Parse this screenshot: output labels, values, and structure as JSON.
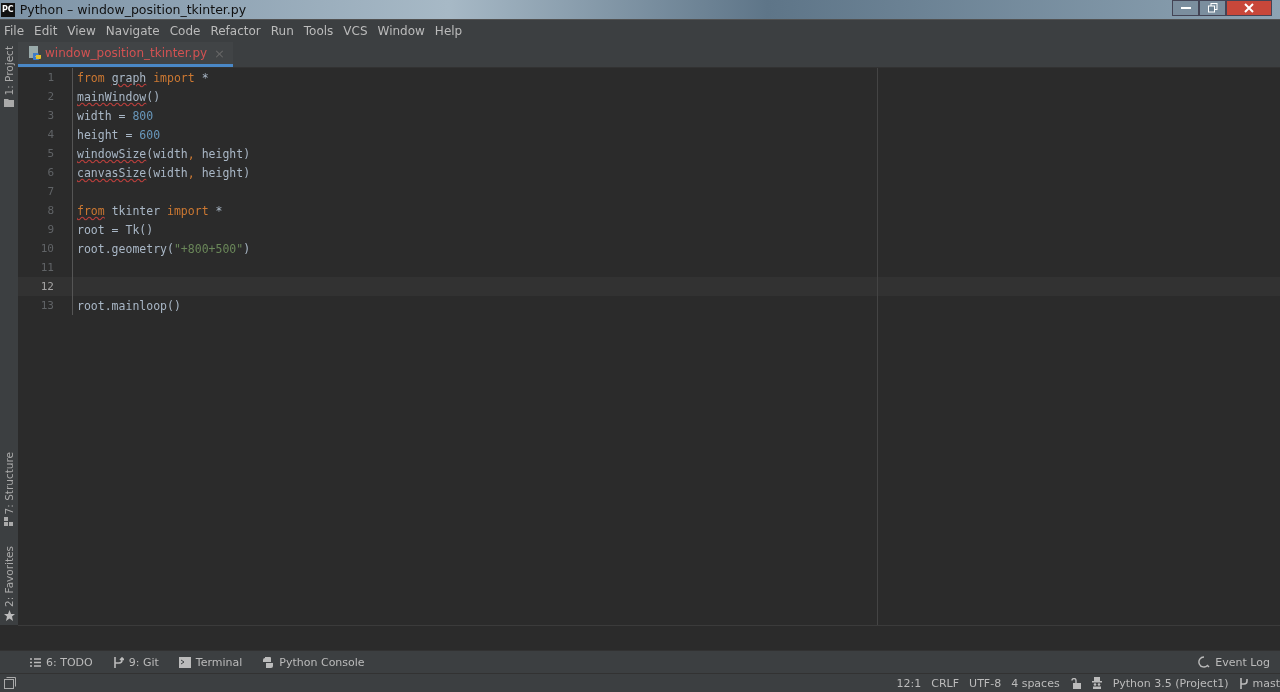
{
  "window": {
    "title": "Python – window_position_tkinter.py",
    "app_badge": "PC"
  },
  "menu": [
    "File",
    "Edit",
    "View",
    "Navigate",
    "Code",
    "Refactor",
    "Run",
    "Tools",
    "VCS",
    "Window",
    "Help"
  ],
  "tabs": [
    {
      "label": "window_position_tkinter.py",
      "selected": true,
      "error": true,
      "close": "×"
    }
  ],
  "left_tools": [
    {
      "label": "1: Project",
      "kind": "folder"
    },
    {
      "label": "7: Structure",
      "kind": "structure"
    },
    {
      "label": "2: Favorites",
      "kind": "star"
    }
  ],
  "code": [
    {
      "number": "1",
      "current": false,
      "tokens": [
        {
          "text": "from ",
          "kind": "keyword",
          "error": false
        },
        {
          "text": "graph",
          "kind": "plain",
          "error": true
        },
        {
          "text": " import",
          "kind": "keyword",
          "error": false
        },
        {
          "text": " *",
          "kind": "plain",
          "error": false
        }
      ]
    },
    {
      "number": "2",
      "current": false,
      "tokens": [
        {
          "text": "mainWindow",
          "kind": "plain",
          "error": true
        },
        {
          "text": "()",
          "kind": "plain",
          "error": false
        }
      ]
    },
    {
      "number": "3",
      "current": false,
      "tokens": [
        {
          "text": "width = ",
          "kind": "plain",
          "error": false
        },
        {
          "text": "800",
          "kind": "number",
          "error": false
        }
      ]
    },
    {
      "number": "4",
      "current": false,
      "tokens": [
        {
          "text": "height = ",
          "kind": "plain",
          "error": false
        },
        {
          "text": "600",
          "kind": "number",
          "error": false
        }
      ]
    },
    {
      "number": "5",
      "current": false,
      "tokens": [
        {
          "text": "windowSize",
          "kind": "plain",
          "error": true
        },
        {
          "text": "(width",
          "kind": "plain",
          "error": false
        },
        {
          "text": ",",
          "kind": "keyword",
          "error": false
        },
        {
          "text": " height)",
          "kind": "plain",
          "error": false
        }
      ]
    },
    {
      "number": "6",
      "current": false,
      "tokens": [
        {
          "text": "canvasSize",
          "kind": "plain",
          "error": true
        },
        {
          "text": "(width",
          "kind": "plain",
          "error": false
        },
        {
          "text": ",",
          "kind": "keyword",
          "error": false
        },
        {
          "text": " height)",
          "kind": "plain",
          "error": false
        }
      ]
    },
    {
      "number": "7",
      "current": false
    },
    {
      "number": "8",
      "current": false,
      "tokens": [
        {
          "text": "from",
          "kind": "keyword",
          "error": true
        },
        {
          "text": " tkinter ",
          "kind": "plain",
          "error": false
        },
        {
          "text": "import",
          "kind": "keyword",
          "error": false
        },
        {
          "text": " *",
          "kind": "plain",
          "error": false
        }
      ]
    },
    {
      "number": "9",
      "current": false,
      "tokens": [
        {
          "text": "root = Tk()",
          "kind": "plain",
          "error": false
        }
      ]
    },
    {
      "number": "10",
      "current": false,
      "tokens": [
        {
          "text": "root.geometry(",
          "kind": "plain",
          "error": false
        },
        {
          "text": "\"+800+500\"",
          "kind": "string",
          "error": false
        },
        {
          "text": ")",
          "kind": "plain",
          "error": false
        }
      ]
    },
    {
      "number": "11",
      "current": false
    },
    {
      "number": "12",
      "current": true
    },
    {
      "number": "13",
      "current": false,
      "tokens": [
        {
          "text": "root.mainloop()",
          "kind": "plain",
          "error": false
        }
      ]
    }
  ],
  "bottom_tools": [
    {
      "label": "6: TODO",
      "kind": "list"
    },
    {
      "label": "9: Git",
      "kind": "branch"
    },
    {
      "label": "Terminal",
      "kind": "terminal"
    },
    {
      "label": "Python Console",
      "kind": "python"
    }
  ],
  "event_log": "Event Log",
  "status_bar": {
    "position": "12:1",
    "line_ending": "CRLF",
    "encoding": "UTF-8",
    "indent": "4 spaces",
    "interpreter": "Python 3.5 (Project1)",
    "branch": "mast"
  }
}
